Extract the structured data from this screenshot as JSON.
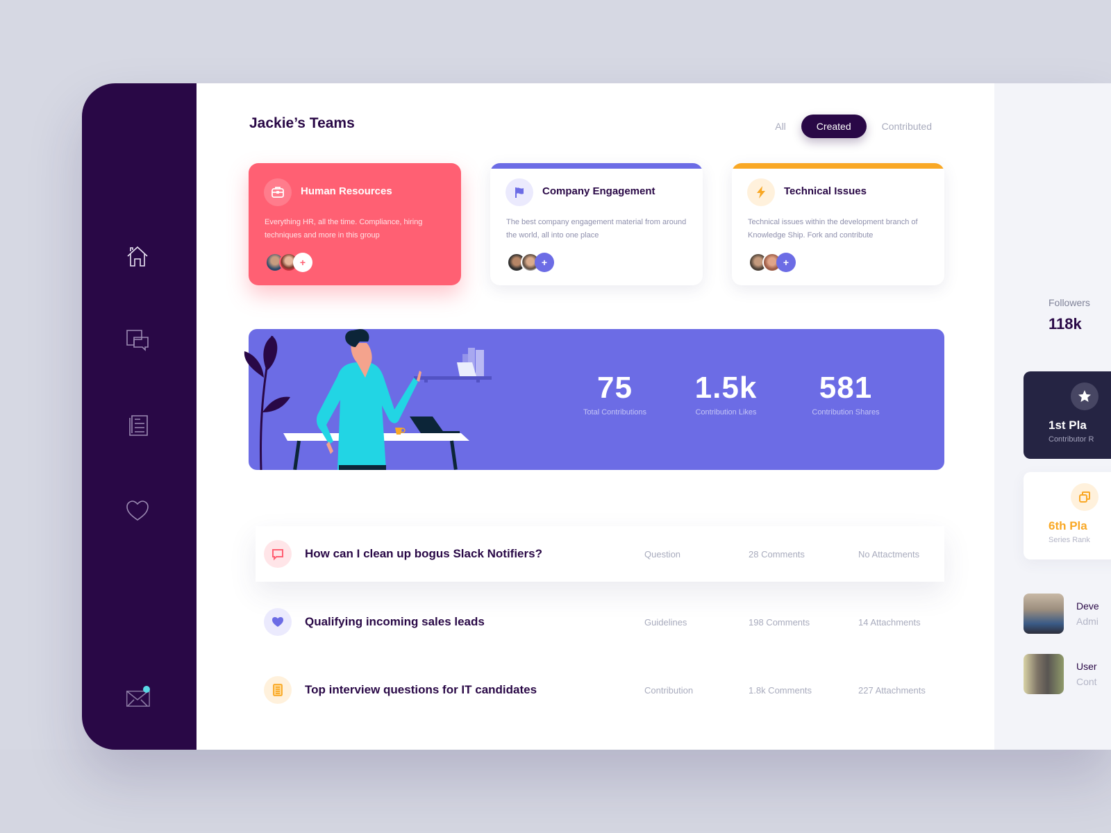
{
  "page": {
    "title": "Jackie’s Teams",
    "filters": [
      {
        "label": "All",
        "active": false
      },
      {
        "label": "Created",
        "active": true
      },
      {
        "label": "Contributed",
        "active": false
      }
    ]
  },
  "sidebar": {
    "items": [
      {
        "icon": "home-icon",
        "label": "Home"
      },
      {
        "icon": "chat-icon",
        "label": "Messages"
      },
      {
        "icon": "document-icon",
        "label": "Documents"
      },
      {
        "icon": "heart-icon",
        "label": "Favorites"
      },
      {
        "icon": "mail-icon",
        "label": "Mail",
        "notification": true
      }
    ]
  },
  "teams": [
    {
      "title": "Human Resources",
      "description": "Everything HR, all the time. Compliance, hiring techniques and more in this group",
      "icon": "briefcase-icon",
      "accent": "#ff6073",
      "add_label": "+"
    },
    {
      "title": "Company Engagement",
      "description": "The best company engagement material from around the world, all into one place",
      "icon": "flag-icon",
      "accent": "#6c6ce5",
      "add_label": "+"
    },
    {
      "title": "Technical Issues",
      "description": "Technical issues within the development branch of Knowledge Ship. Fork and contribute",
      "icon": "lightning-icon",
      "accent": "#f9a825",
      "add_label": "+"
    }
  ],
  "stats": [
    {
      "value": "75",
      "label": "Total Contributions"
    },
    {
      "value": "1.5k",
      "label": "Contribution Likes"
    },
    {
      "value": "581",
      "label": "Contribution Shares"
    }
  ],
  "posts": [
    {
      "title": "How can I clean up bogus Slack Notifiers?",
      "type": "Question",
      "comments": "28 Comments",
      "attachments": "No Attactments",
      "icon": "chat-bubble-icon"
    },
    {
      "title": "Qualifying incoming sales leads",
      "type": "Guidelines",
      "comments": "198 Comments",
      "attachments": "14 Attachments",
      "icon": "heart-icon"
    },
    {
      "title": "Top interview questions for IT candidates",
      "type": "Contribution",
      "comments": "1.8k Comments",
      "attachments": "227 Attachments",
      "icon": "list-icon"
    }
  ],
  "profile": {
    "followers_label": "Followers",
    "followers_value": "118k",
    "ranks": [
      {
        "title": "1st Pla",
        "subtitle": "Contributor R",
        "icon": "star-icon"
      },
      {
        "title": "6th Pla",
        "subtitle": "Series Rank",
        "icon": "copy-icon"
      }
    ],
    "groups": [
      {
        "name": "Deve",
        "role": "Admi"
      },
      {
        "name": "User",
        "role": "Cont"
      }
    ]
  },
  "colors": {
    "sidebar": "#290846",
    "primary": "#6c6ce5",
    "coral": "#ff6073",
    "amber": "#f9a825",
    "notification": "#5ad8e6"
  }
}
